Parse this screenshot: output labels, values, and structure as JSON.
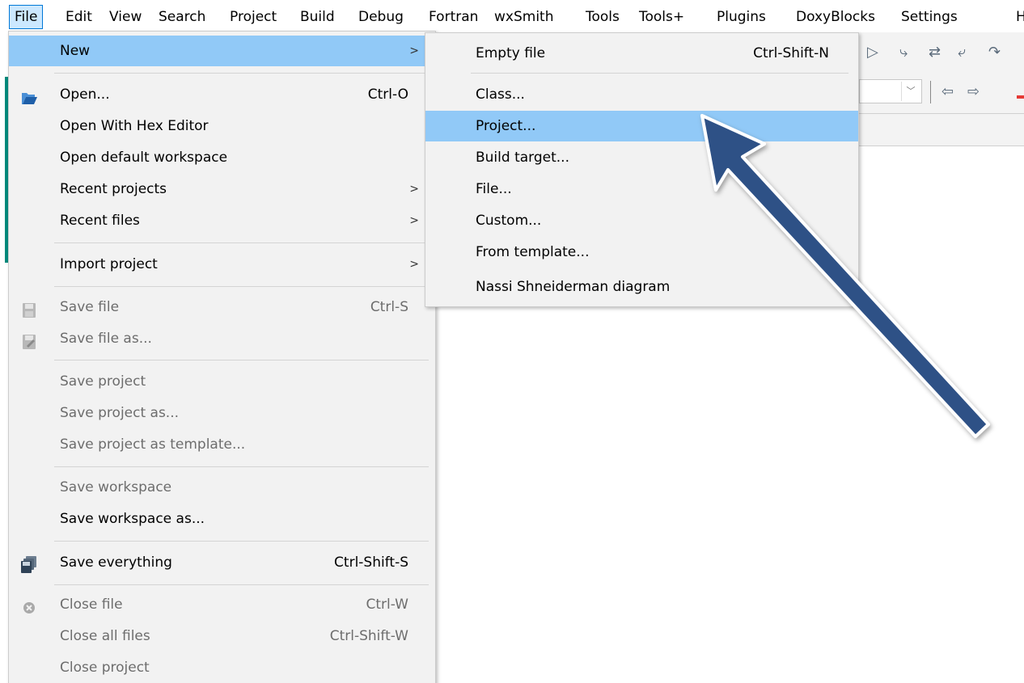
{
  "menubar": {
    "items": [
      "File",
      "Edit",
      "View",
      "Search",
      "Project",
      "Build",
      "Debug",
      "Fortran",
      "wxSmith",
      "Tools",
      "Tools+",
      "Plugins",
      "DoxyBlocks",
      "Settings",
      "H"
    ]
  },
  "file_menu": {
    "items": [
      {
        "label": "New",
        "shortcut": "",
        "submenu": true,
        "highlighted": true,
        "disabled": false,
        "icon": ""
      },
      {
        "label": "Open...",
        "shortcut": "Ctrl-O",
        "submenu": false,
        "disabled": false,
        "icon": "folder-open-icon"
      },
      {
        "label": "Open With Hex Editor",
        "shortcut": "",
        "submenu": false,
        "disabled": false,
        "icon": ""
      },
      {
        "label": "Open default workspace",
        "shortcut": "",
        "submenu": false,
        "disabled": false,
        "icon": ""
      },
      {
        "label": "Recent projects",
        "shortcut": "",
        "submenu": true,
        "disabled": false,
        "icon": ""
      },
      {
        "label": "Recent files",
        "shortcut": "",
        "submenu": true,
        "disabled": false,
        "icon": ""
      },
      {
        "label": "Import project",
        "shortcut": "",
        "submenu": true,
        "disabled": false,
        "icon": ""
      },
      {
        "label": "Save file",
        "shortcut": "Ctrl-S",
        "submenu": false,
        "disabled": true,
        "icon": "save-file-icon"
      },
      {
        "label": "Save file as...",
        "shortcut": "",
        "submenu": false,
        "disabled": true,
        "icon": "save-file-as-icon"
      },
      {
        "label": "Save project",
        "shortcut": "",
        "submenu": false,
        "disabled": true,
        "icon": ""
      },
      {
        "label": "Save project as...",
        "shortcut": "",
        "submenu": false,
        "disabled": true,
        "icon": ""
      },
      {
        "label": "Save project as template...",
        "shortcut": "",
        "submenu": false,
        "disabled": true,
        "icon": ""
      },
      {
        "label": "Save workspace",
        "shortcut": "",
        "submenu": false,
        "disabled": true,
        "icon": ""
      },
      {
        "label": "Save workspace as...",
        "shortcut": "",
        "submenu": false,
        "disabled": false,
        "icon": ""
      },
      {
        "label": "Save everything",
        "shortcut": "Ctrl-Shift-S",
        "submenu": false,
        "disabled": false,
        "icon": "save-everything-icon"
      },
      {
        "label": "Close file",
        "shortcut": "Ctrl-W",
        "submenu": false,
        "disabled": true,
        "icon": "close-file-icon"
      },
      {
        "label": "Close all files",
        "shortcut": "Ctrl-Shift-W",
        "submenu": false,
        "disabled": true,
        "icon": ""
      },
      {
        "label": "Close project",
        "shortcut": "",
        "submenu": false,
        "disabled": true,
        "icon": ""
      }
    ]
  },
  "new_menu": {
    "items": [
      {
        "label": "Empty file",
        "shortcut": "Ctrl-Shift-N",
        "highlighted": false
      },
      {
        "label": "Class...",
        "shortcut": "",
        "highlighted": false
      },
      {
        "label": "Project...",
        "shortcut": "",
        "highlighted": true
      },
      {
        "label": "Build target...",
        "shortcut": "",
        "highlighted": false
      },
      {
        "label": "File...",
        "shortcut": "",
        "highlighted": false
      },
      {
        "label": "Custom...",
        "shortcut": "",
        "highlighted": false
      },
      {
        "label": "From template...",
        "shortcut": "",
        "highlighted": false
      },
      {
        "label": "Nassi Shneiderman diagram",
        "shortcut": "",
        "highlighted": false
      }
    ]
  },
  "annotation": {
    "arrow_color": "#2e5186",
    "arrow_points_to": "Project..."
  },
  "colors": {
    "highlight": "#91c9f7",
    "menu_bg": "#f2f2f2",
    "disabled_text": "#6d6d6d"
  }
}
